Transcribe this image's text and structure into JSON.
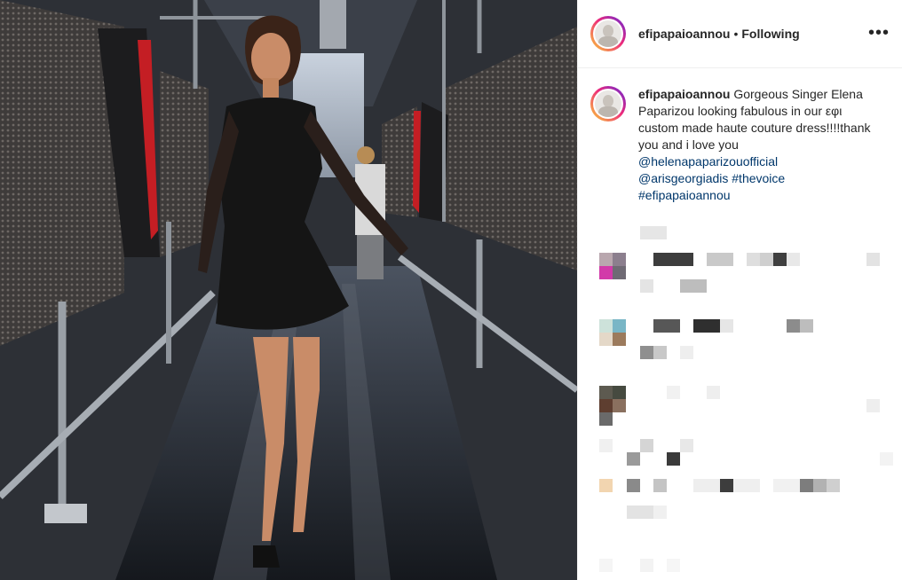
{
  "header": {
    "username": "efipapaioannou",
    "separator": "•",
    "follow_status": "Following",
    "more_icon": "more-horizontal-icon"
  },
  "caption": {
    "username": "efipapaioannou",
    "text": " Gorgeous Singer Elena Paparizou looking fabulous in our εφι custom made haute couture dress!!!!thank you and i love you ",
    "mentions": [
      "@helenapaparizouofficial",
      "@arisgeorgiadis"
    ],
    "hashtags": [
      "#thevoice",
      "#efipapaioannou"
    ]
  },
  "colors": {
    "link": "#00376b",
    "text": "#262626",
    "ring_gradient": [
      "#f9ce34",
      "#ee2a7b",
      "#6228d7"
    ]
  }
}
